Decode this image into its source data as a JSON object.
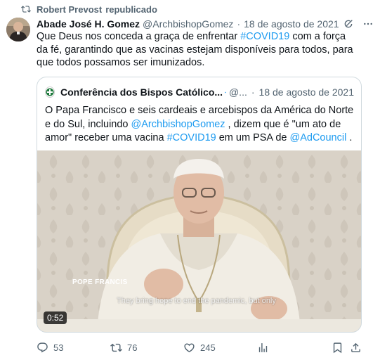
{
  "repost": {
    "user": "Robert Prevost",
    "label": "republicado"
  },
  "tweet": {
    "author_name": "Abade José H. Gomez",
    "author_handle": "@ArchbishopGomez",
    "separator": "·",
    "date": "18 de agosto de 2021",
    "text_parts": {
      "p1": "Que Deus nos conceda a graça de enfrentar ",
      "hashtag": "#COVID19",
      "p2": " com a força da fé, garantindo que as vacinas estejam disponíveis para todos, para que todos possamos ser imunizados."
    }
  },
  "quote": {
    "author_name": "Conferência dos Bispos Católico...",
    "author_handle": "@...",
    "separator": "·",
    "date": "18 de agosto de 2021",
    "text_parts": {
      "p1": "O Papa Francisco e seis cardeais e arcebispos da América do Norte e do Sul, incluindo ",
      "mention1": "@ArchbishopGomez",
      "p2": " , dizem que é \"um ato de amor\" receber uma  vacina ",
      "hashtag": "#COVID19",
      "p3": "  em um PSA de  ",
      "mention2": "@AdCouncil",
      "p4": " ."
    },
    "video": {
      "overlay_label": "POPE FRANCIS",
      "subtitle": "They bring hope to end the pandemic, but only",
      "duration": "0:52"
    }
  },
  "actions": {
    "replies": "53",
    "reposts": "76",
    "likes": "245"
  },
  "colors": {
    "link": "#1d9bf0",
    "secondary_text": "#536471",
    "verified": "#1d9bf0",
    "border": "#cfd9de"
  },
  "icons": [
    "repost-icon",
    "grok-icon",
    "more-icon",
    "verified-badge-icon",
    "reply-icon",
    "like-icon",
    "views-icon",
    "bookmark-icon",
    "share-icon"
  ]
}
